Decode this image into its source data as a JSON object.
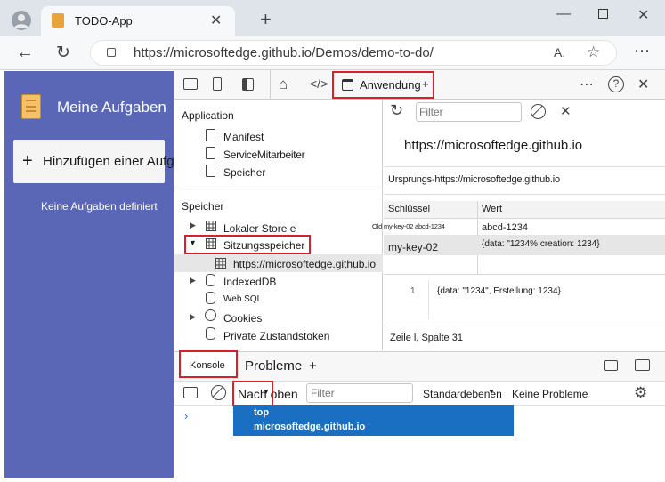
{
  "browser": {
    "tab_title": "TODO-App",
    "url": "https://microsoftedge.github.io/Demos/demo-to-do/"
  },
  "app": {
    "title": "Meine Aufgaben",
    "add_button": "Hinzufügen einer Aufgabe",
    "empty_text": "Keine Aufgaben definiert"
  },
  "devtools": {
    "active_tab": "Anwendung",
    "tree": {
      "application_header": "Application",
      "application_items": [
        "Manifest",
        "ServiceMitarbeiter",
        "Speicher"
      ],
      "storage_header": "Speicher",
      "local_storage": "Lokaler Store e",
      "session_storage": "Sitzungsspeicher",
      "session_origin": "https://microsoftedge.github.io",
      "indexeddb": "IndexedDB",
      "websql": "Web SQL",
      "cookies": "Cookies",
      "private_tokens": "Private Zustandstoken"
    },
    "storage_view": {
      "filter_placeholder": "Filter",
      "origin": "https://microsoftedge.github.io",
      "origin_label": "Ursprungs-https://microsoftedge.github.io",
      "columns": [
        "Schlüssel",
        "Wert"
      ],
      "rows": [
        {
          "key": "Old my-key-02 abcd-1234",
          "value": "abcd-1234"
        },
        {
          "key": "my-key-02",
          "value": "{data: \"1234% creation: 1234}"
        }
      ],
      "preview_line": "1",
      "preview_value": "{data: \"1234\", Erstellung: 1234}",
      "status": "Zeile l, Spalte 31"
    },
    "drawer": {
      "console_tab": "Konsole",
      "issues_tab": "Probleme",
      "context_label": "Nach oben",
      "filter_placeholder": "Filter",
      "levels": "Standardebenen",
      "issues": "Keine Probleme",
      "context_options": [
        "top",
        "microsoftedge.github.io"
      ]
    }
  }
}
